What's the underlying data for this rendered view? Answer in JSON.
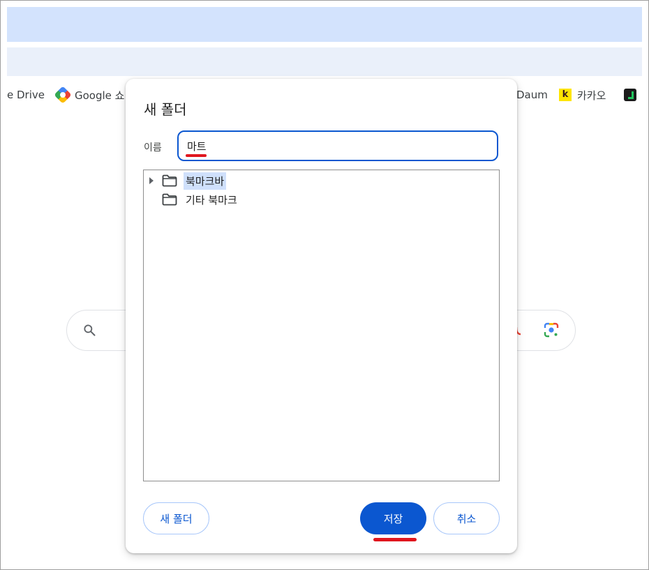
{
  "bookmarks": {
    "drive_label": "e Drive",
    "google_label": "Google 쇼",
    "daum_label": "Daum",
    "kakao_label": "카카오",
    "kakao_icon_letter": "k"
  },
  "dialog": {
    "title": "새 폴더",
    "name_label": "이름",
    "name_value": "마트",
    "folders": [
      {
        "label": "북마크바",
        "expandable": true,
        "selected": true
      },
      {
        "label": "기타 북마크",
        "expandable": false,
        "selected": false
      }
    ],
    "new_folder_button": "새 폴더",
    "save_button": "저장",
    "cancel_button": "취소"
  },
  "colors": {
    "accent": "#0b57d0",
    "highlight_underline": "#e0161e",
    "topbar": "#d3e3fd",
    "selected_row": "#cfe0fb"
  }
}
